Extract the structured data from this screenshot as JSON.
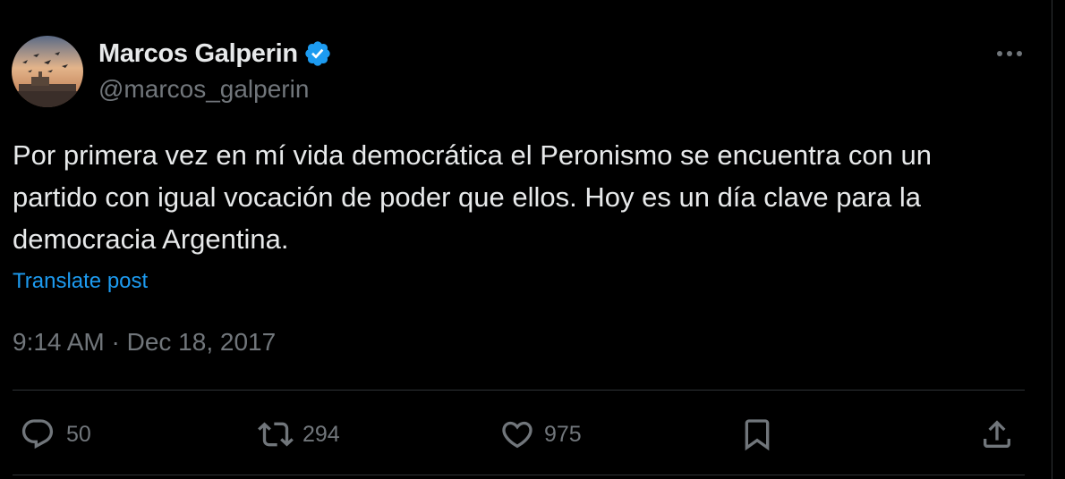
{
  "user": {
    "display_name": "Marcos Galperin",
    "handle": "@marcos_galperin",
    "verified": true
  },
  "post": {
    "text": "Por primera vez en mí vida democrática el Peronismo se encuentra con un partido con igual vocación de poder que ellos. Hoy es un día clave para la democracia Argentina.",
    "translate_label": "Translate post",
    "timestamp": "9:14 AM · Dec 18, 2017"
  },
  "actions": {
    "replies": "50",
    "reposts": "294",
    "likes": "975"
  },
  "icons": [
    "verified-badge-icon",
    "more-icon",
    "reply-icon",
    "repost-icon",
    "like-icon",
    "bookmark-icon",
    "share-icon"
  ],
  "colors": {
    "background": "#000000",
    "text": "#e7e9ea",
    "muted": "#71767b",
    "link": "#1d9bf0",
    "verified": "#1d9bf0",
    "divider": "#2f3336"
  }
}
